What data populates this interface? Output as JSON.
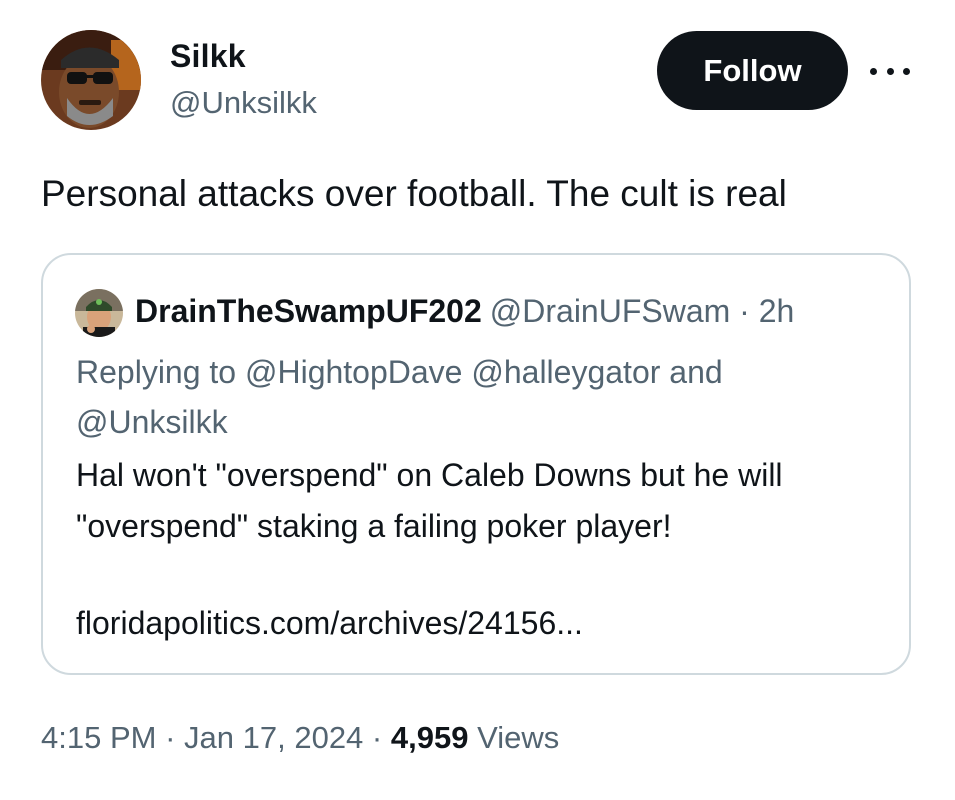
{
  "author": {
    "display_name": "Silkk",
    "handle": "@Unksilkk"
  },
  "follow_label": "Follow",
  "tweet_text": "Personal attacks over football. The cult is real",
  "quote": {
    "display_name": "DrainTheSwampUF202",
    "handle": "@DrainUFSwam",
    "separator": "·",
    "time": "2h",
    "replying_prefix": "Replying to",
    "mention_1": "@HightopDave",
    "mention_2": "@halleygator",
    "replying_and": "and",
    "mention_3": "@Unksilkk",
    "body": "Hal won't \"overspend\" on Caleb Downs but he will \"overspend\" staking a failing poker player!",
    "link": "floridapolitics.com/archives/24156..."
  },
  "meta": {
    "time": "4:15 PM",
    "separator": "·",
    "date": "Jan 17, 2024",
    "views_count": "4,959",
    "views_label": "Views"
  },
  "colors": {
    "text_primary": "#0f1419",
    "text_secondary": "#536471",
    "border": "#cfd9de",
    "follow_bg": "#0f1419"
  }
}
